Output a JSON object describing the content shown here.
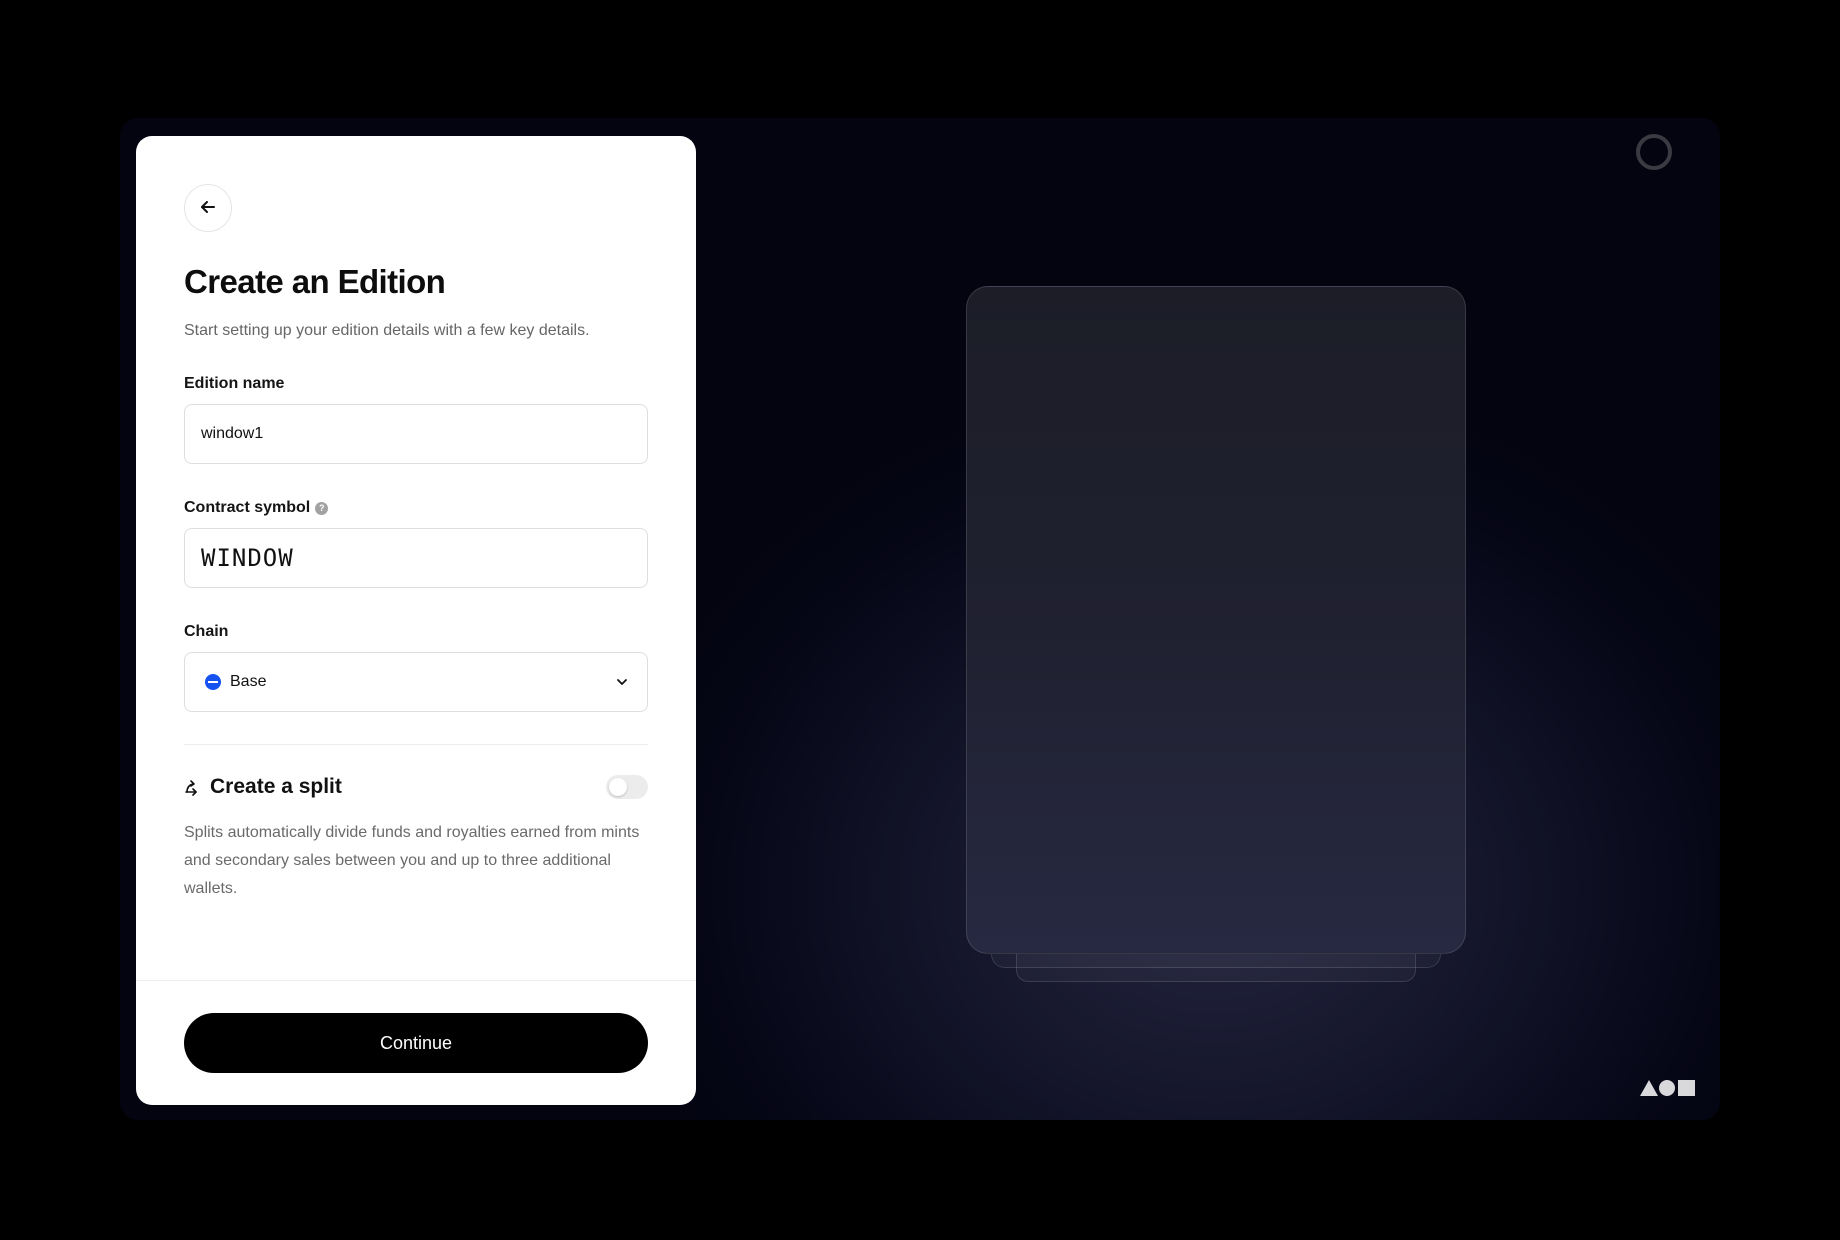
{
  "panel": {
    "title": "Create an Edition",
    "subtitle": "Start setting up your edition details with a few key details.",
    "fields": {
      "edition_name": {
        "label": "Edition name",
        "value": "window1"
      },
      "contract_symbol": {
        "label": "Contract symbol",
        "value": "WINDOW",
        "help": "?"
      },
      "chain": {
        "label": "Chain",
        "selected": "Base"
      }
    },
    "split": {
      "title": "Create a split",
      "enabled": false,
      "description": "Splits automatically divide funds and royalties earned from mints and secondary sales between you and up to three additional wallets."
    },
    "continue_label": "Continue"
  },
  "colors": {
    "accent_chain": "#1652f0",
    "primary_button": "#000000",
    "background": "#060717"
  },
  "icons": {
    "back": "arrow-left-icon",
    "help": "question-icon",
    "chain": "base-chain-icon",
    "chevron": "chevron-down-icon",
    "split": "split-icon",
    "loader": "loading-ring-icon",
    "brand": "shapes-logo"
  }
}
